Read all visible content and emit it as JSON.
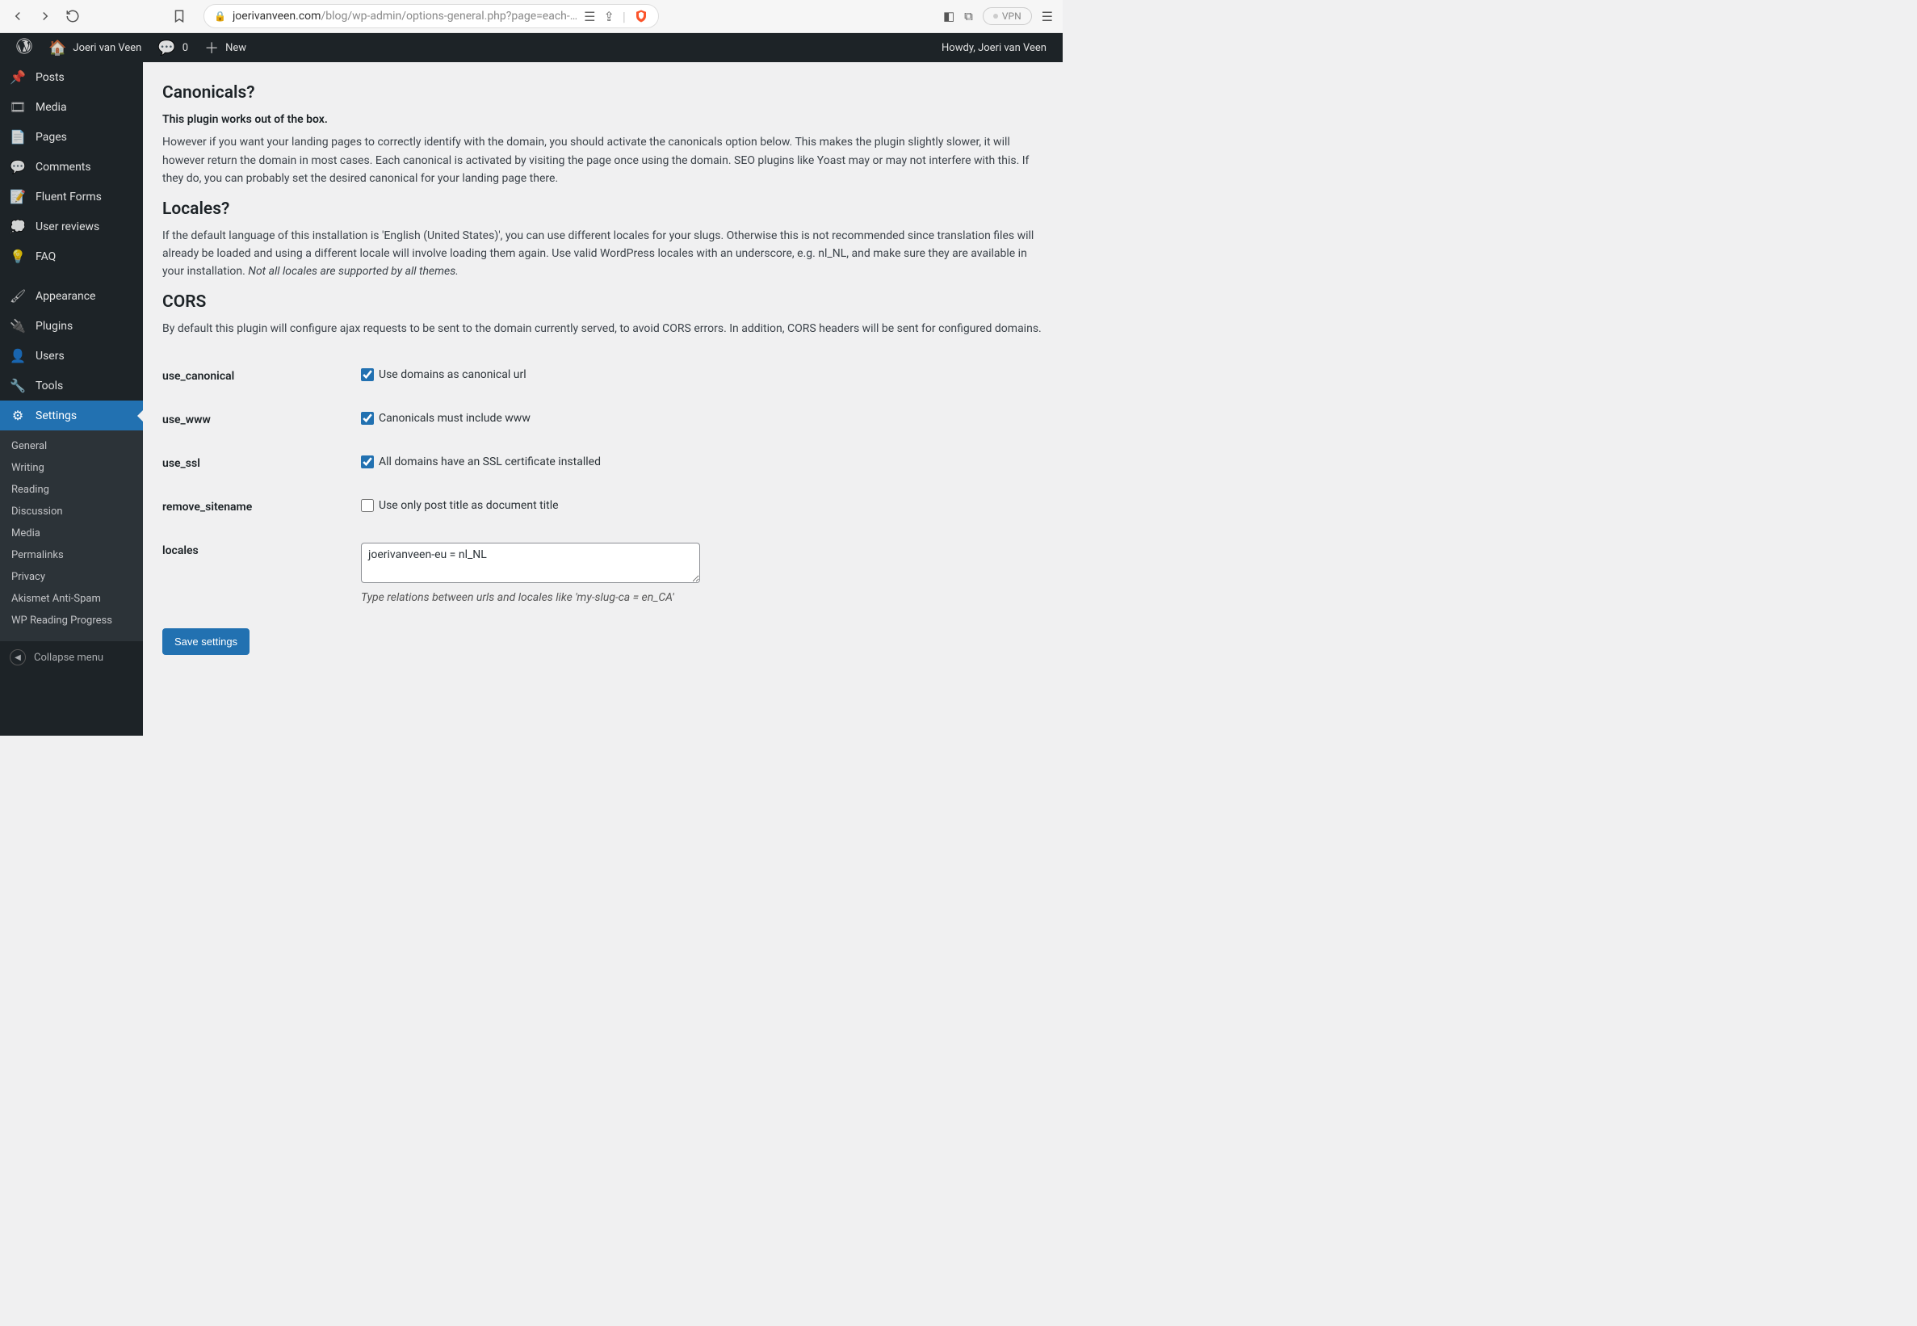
{
  "browser": {
    "url_domain": "joerivanveen.com",
    "url_path": "/blog/wp-admin/options-general.php?page=each-…",
    "vpn_label": "VPN"
  },
  "adminbar": {
    "site_name": "Joeri van Veen",
    "comments_count": "0",
    "new_label": "New",
    "howdy": "Howdy, Joeri van Veen"
  },
  "sidebar": {
    "items": [
      {
        "label": "Posts",
        "icon": "📌"
      },
      {
        "label": "Media",
        "icon": "🎞"
      },
      {
        "label": "Pages",
        "icon": "📄"
      },
      {
        "label": "Comments",
        "icon": "💬"
      },
      {
        "label": "Fluent Forms",
        "icon": "📝"
      },
      {
        "label": "User reviews",
        "icon": "💭"
      },
      {
        "label": "FAQ",
        "icon": "💡"
      }
    ],
    "items2": [
      {
        "label": "Appearance",
        "icon": "🖌"
      },
      {
        "label": "Plugins",
        "icon": "🔌"
      },
      {
        "label": "Users",
        "icon": "👤"
      },
      {
        "label": "Tools",
        "icon": "🔧"
      },
      {
        "label": "Settings",
        "icon": "⚙",
        "current": true
      }
    ],
    "submenu": [
      "General",
      "Writing",
      "Reading",
      "Discussion",
      "Media",
      "Permalinks",
      "Privacy",
      "Akismet Anti-Spam",
      "WP Reading Progress"
    ],
    "collapse": "Collapse menu"
  },
  "content": {
    "h_canonicals": "Canonicals?",
    "p_out_of_box": "This plugin works out of the box.",
    "p_canon_rest": "However if you want your landing pages to correctly identify with the domain, you should activate the canonicals option below. This makes the plugin slightly slower, it will however return the domain in most cases. Each canonical is activated by visiting the page once using the domain. SEO plugins like Yoast may or may not interfere with this. If they do, you can probably set the desired canonical for your landing page there.",
    "h_locales": "Locales?",
    "p_locales_1": "If the default language of this installation is 'English (United States)', you can use different locales for your slugs. Otherwise this is not recommended since translation files will already be loaded and using a different locale will involve loading them again. Use valid WordPress locales with an underscore, e.g. nl_NL, and make sure they are available in your installation.",
    "p_locales_em": " Not all locales are supported by all themes.",
    "h_cors": "CORS",
    "p_cors": "By default this plugin will configure ajax requests to be sent to the domain currently served, to avoid CORS errors. In addition, CORS headers will be sent for configured domains.",
    "fields": {
      "use_canonical": {
        "label": "use_canonical",
        "text": "Use domains as canonical url",
        "checked": true
      },
      "use_www": {
        "label": "use_www",
        "text": "Canonicals must include www",
        "checked": true
      },
      "use_ssl": {
        "label": "use_ssl",
        "text": "All domains have an SSL certificate installed",
        "checked": true
      },
      "remove_sitename": {
        "label": "remove_sitename",
        "text": "Use only post title as document title",
        "checked": false
      },
      "locales": {
        "label": "locales",
        "value": "joerivanveen-eu = nl_NL",
        "hint": "Type relations between urls and locales like 'my-slug-ca = en_CA'"
      }
    },
    "save_button": "Save settings"
  }
}
